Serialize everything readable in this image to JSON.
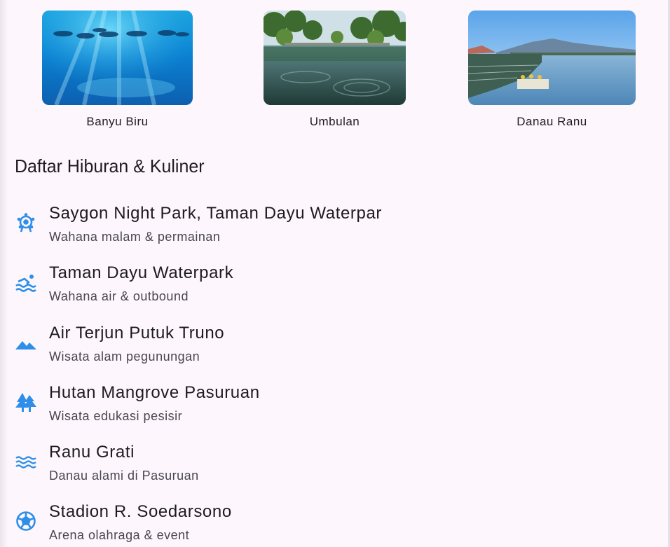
{
  "gallery": [
    {
      "name": "Banyu Biru",
      "image": "underwater-blue-fish-photo"
    },
    {
      "name": "Umbulan",
      "image": "spring-pool-trees-photo"
    },
    {
      "name": "Danau Ranu",
      "image": "lake-pier-mountains-photo"
    }
  ],
  "section": {
    "title": "Daftar Hiburan & Kuliner"
  },
  "list": [
    {
      "title": "Saygon Night Park, Taman Dayu Waterpar",
      "subtitle": "Wahana malam & permainan",
      "icon": "ferris-wheel-icon"
    },
    {
      "title": "Taman Dayu Waterpark",
      "subtitle": "Wahana air & outbound",
      "icon": "swimming-pool-icon"
    },
    {
      "title": "Air Terjun Putuk Truno",
      "subtitle": "Wisata alam pegunungan",
      "icon": "landscape-icon"
    },
    {
      "title": "Hutan Mangrove Pasuruan",
      "subtitle": "Wisata edukasi pesisir",
      "icon": "forest-icon"
    },
    {
      "title": "Ranu Grati",
      "subtitle": "Danau alami di Pasuruan",
      "icon": "water-waves-icon"
    },
    {
      "title": "Stadion R. Soedarsono",
      "subtitle": "Arena olahraga & event",
      "icon": "soccer-ball-icon"
    }
  ],
  "colors": {
    "accent": "#2f8fe8",
    "background": "#fdf7fd",
    "text": "#1d1b20",
    "subtext": "#49454f"
  }
}
